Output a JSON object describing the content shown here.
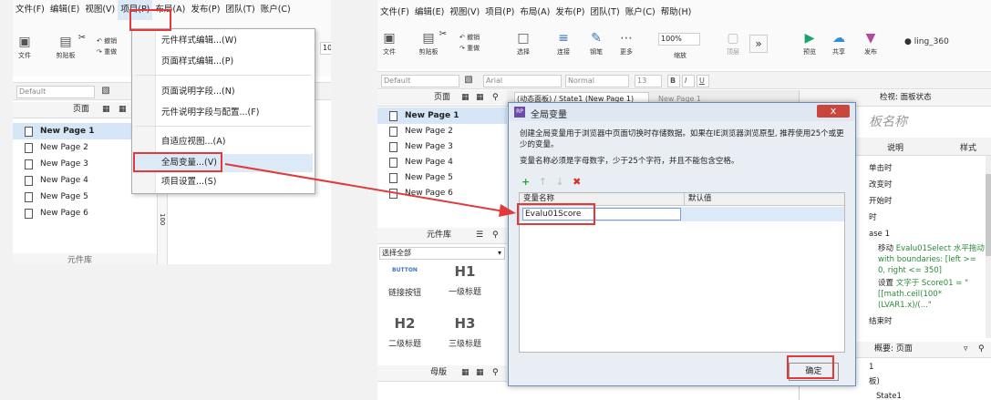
{
  "left": {
    "menu": [
      "文件(F)",
      "编辑(E)",
      "视图(V)",
      "项目(P)",
      "布局(A)",
      "发布(P)",
      "团队(T)",
      "账户(C)"
    ],
    "toolbar": {
      "file_label": "文件",
      "clipboard_label": "剪贴板",
      "undo_label": "撤销",
      "redo_label": "重做",
      "partial_value": "10"
    },
    "style_combo": "Default",
    "pages_title": "页面",
    "pages": [
      "New Page 1",
      "New Page 2",
      "New Page 3",
      "New Page 4",
      "New Page 5",
      "New Page 6"
    ],
    "library_title": "元件库",
    "ruler_value": "100"
  },
  "project_menu": {
    "items": [
      "元件样式编辑...(W)",
      "页面样式编辑...(P)",
      "页面说明字段...(N)",
      "元件说明字段与配置...(F)",
      "自适应视图...(A)",
      "全局变量...(V)",
      "项目设置...(S)"
    ]
  },
  "right": {
    "menu": [
      "文件(F)",
      "编辑(E)",
      "视图(V)",
      "项目(P)",
      "布局(A)",
      "发布(P)",
      "团队(T)",
      "账户(C)",
      "帮助(H)"
    ],
    "toolbar": {
      "file_label": "文件",
      "clipboard_label": "剪贴板",
      "undo_label": "撤销",
      "redo_label": "重做",
      "select_label": "选择",
      "connect_label": "连接",
      "pen_label": "钢笔",
      "more_label": "更多",
      "zoom_value": "100%",
      "zoom_label": "缩放",
      "top_label": "顶层",
      "preview_label": "预览",
      "share_label": "共享",
      "publish_label": "发布",
      "user": "ling_360"
    },
    "format": {
      "style": "Default",
      "font": "Arial",
      "weight": "Normal",
      "size": "13"
    },
    "pages_title": "页面",
    "pages": [
      "New Page 1",
      "New Page 2",
      "New Page 3",
      "New Page 4",
      "New Page 5",
      "New Page 6"
    ],
    "canvas_tab1": "(动态面板) / State1 (New Page 1)",
    "canvas_tab2": "New Page 1",
    "library_title": "元件库",
    "library_select": "选择全部",
    "widgets": [
      {
        "head": "BUTTON",
        "label": "链接按钮"
      },
      {
        "head": "H1",
        "label": "一级标题"
      },
      {
        "head": "H2",
        "label": "二级标题"
      },
      {
        "head": "H3",
        "label": "三级标题"
      }
    ],
    "master_title": "母版",
    "inspector_title": "检视: 面板状态",
    "panel_name_partial": "板名称",
    "tab_notes": "说明",
    "tab_style": "样式",
    "events": [
      "单击时",
      "改变时",
      "开始时",
      "时",
      "ase 1"
    ],
    "action1_title": "移动",
    "action1_text": "Evalu01Select 水平拖动 with boundaries: [left >= 0, right <= 350]",
    "action2_title": "设置",
    "action2_text": "文字于 Score01 = \"[[math.ceil(100*(LVAR1.x)/(...\"",
    "events_end": "结束时",
    "outline_title": "概要: 页面",
    "outline_item1": "1",
    "outline_item2": "板)",
    "outline_item3": "State1"
  },
  "dialog": {
    "title": "全局变量",
    "desc1": "创建全局变量用于浏览器中页面切换时存储数据。如果在IE浏览器浏览原型, 推荐使用25个或更少的变量。",
    "desc2": "变量名称必须是字母数字，少于25个字符，并且不能包含空格。",
    "col_name": "变量名称",
    "col_default": "默认值",
    "variable_name": "Evalu01Score",
    "variable_default": "",
    "ok_label": "确定",
    "close_glyph": "x"
  },
  "colors": {
    "highlight": "#e23a3a",
    "selection": "#d6e6f6",
    "dialog_title_bg": "#dfe8f2"
  }
}
